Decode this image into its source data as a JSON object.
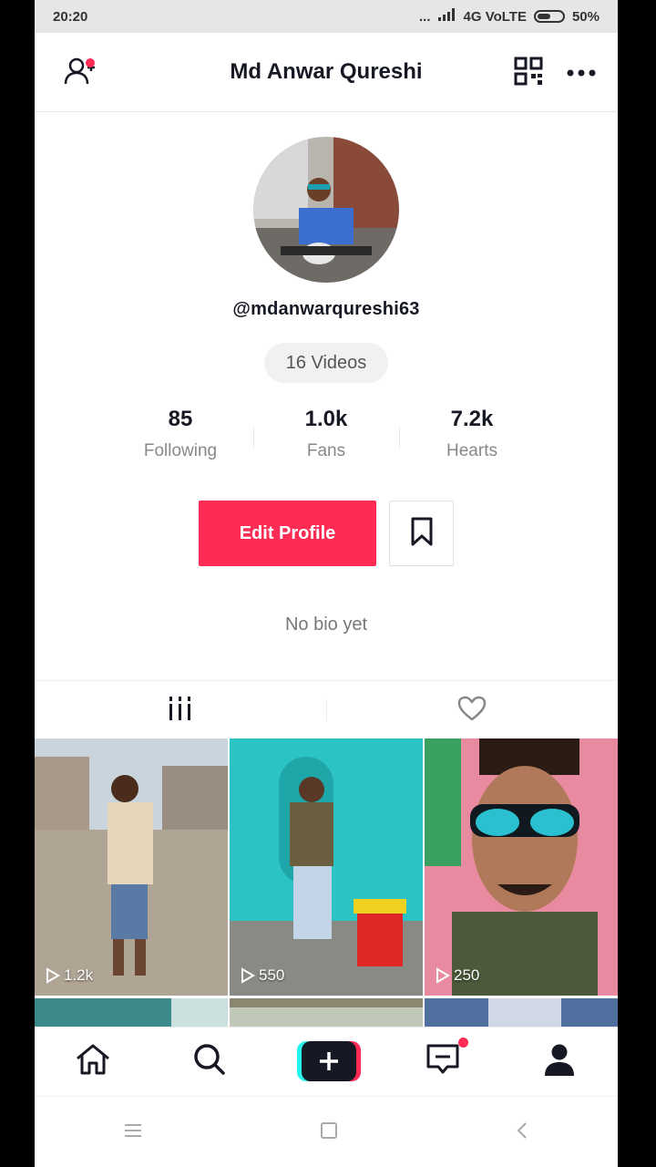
{
  "status": {
    "time": "20:20",
    "signal_text": "...",
    "network": "4G VoLTE",
    "battery": "50%"
  },
  "header": {
    "title": "Md Anwar Qureshi"
  },
  "profile": {
    "username": "@mdanwarqureshi63",
    "videos_label": "16 Videos",
    "stats": [
      {
        "value": "85",
        "label": "Following"
      },
      {
        "value": "1.0k",
        "label": "Fans"
      },
      {
        "value": "7.2k",
        "label": "Hearts"
      }
    ],
    "edit_label": "Edit Profile",
    "bio": "No bio yet"
  },
  "videos": [
    {
      "views": "1.2k"
    },
    {
      "views": "550"
    },
    {
      "views": "250"
    }
  ],
  "colors": {
    "accent": "#fe2c55",
    "cyan": "#25f4ee",
    "dark": "#161823"
  },
  "icons": {
    "header": [
      "add-user-icon",
      "qr-code-icon",
      "more-icon"
    ],
    "tabs": [
      "grid-icon",
      "heart-icon"
    ],
    "bottom_nav": [
      "home-icon",
      "search-icon",
      "create-icon",
      "inbox-icon",
      "profile-icon"
    ],
    "system": [
      "menu-icon",
      "home-square-icon",
      "back-icon"
    ]
  }
}
